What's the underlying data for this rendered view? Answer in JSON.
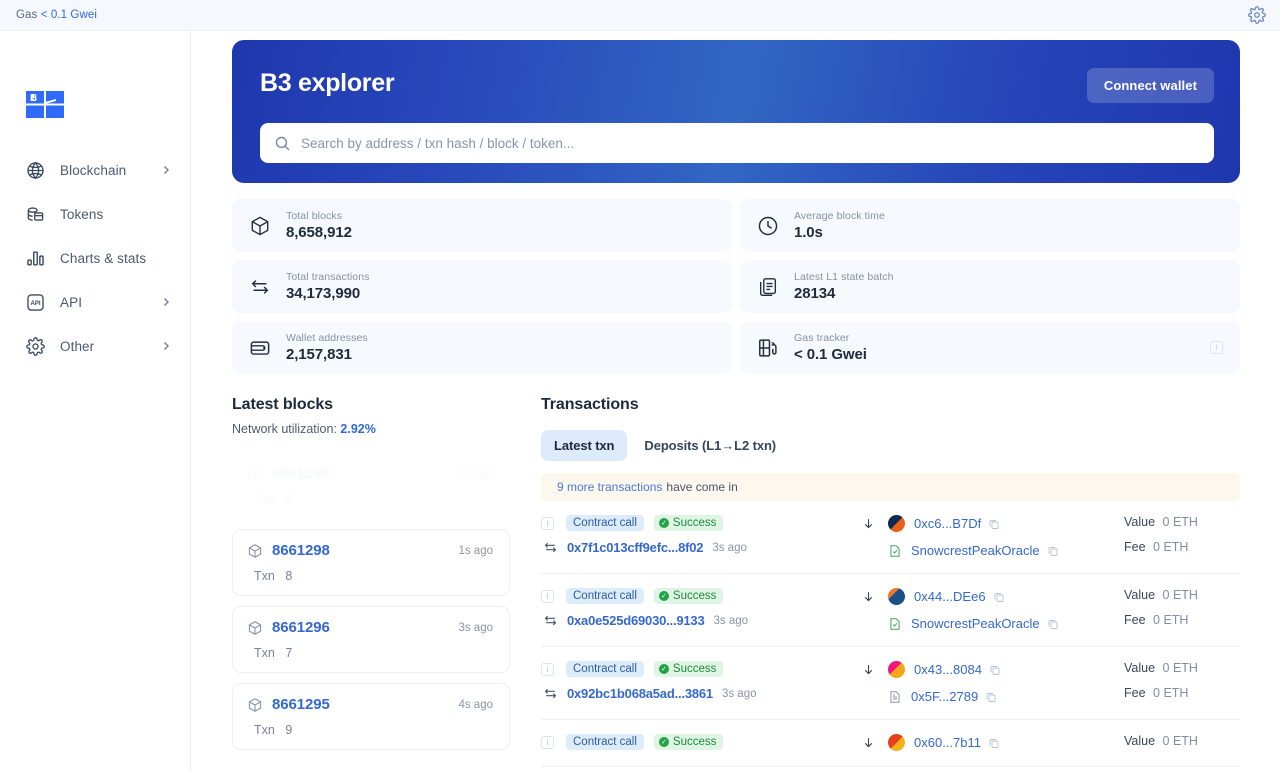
{
  "topbar": {
    "gas_prefix": "Gas",
    "gas_value": "< 0.1 Gwei",
    "gear_icon": "gear-icon"
  },
  "sidebar": {
    "logo_text": "B3",
    "items": [
      {
        "label": "Blockchain",
        "icon": "globe-icon",
        "has_chevron": true
      },
      {
        "label": "Tokens",
        "icon": "coins-icon",
        "has_chevron": false
      },
      {
        "label": "Charts & stats",
        "icon": "bars-icon",
        "has_chevron": false
      },
      {
        "label": "API",
        "icon": "api-icon",
        "has_chevron": true
      },
      {
        "label": "Other",
        "icon": "gear-icon",
        "has_chevron": true
      }
    ]
  },
  "hero": {
    "title": "B3 explorer",
    "connect_label": "Connect wallet",
    "search_placeholder": "Search by address / txn hash / block / token...",
    "search_value": "",
    "search_icon": "search-icon",
    "gradient_from": "#1f37ae",
    "gradient_mid": "#3266c4"
  },
  "stats": {
    "left": [
      {
        "label": "Total blocks",
        "value": "8,658,912",
        "icon": "cube-icon"
      },
      {
        "label": "Total transactions",
        "value": "34,173,990",
        "icon": "swap-icon"
      },
      {
        "label": "Wallet addresses",
        "value": "2,157,831",
        "icon": "wallet-icon"
      }
    ],
    "right": [
      {
        "label": "Average block time",
        "value": "1.0s",
        "icon": "clock-icon",
        "info": false
      },
      {
        "label": "Latest L1 state batch",
        "value": "28134",
        "icon": "docs-icon",
        "info": false
      },
      {
        "label": "Gas tracker",
        "value": "< 0.1 Gwei",
        "icon": "gaspump-icon",
        "info": true
      }
    ]
  },
  "blocks": {
    "title": "Latest blocks",
    "netutil_label": "Network utilization:",
    "netutil_value": "2.92%",
    "txn_label": "Txn",
    "items": [
      {
        "number": "8661299",
        "age": "1s ago",
        "txn": "6",
        "ghost": true
      },
      {
        "number": "8661298",
        "age": "1s ago",
        "txn": "8",
        "ghost": false
      },
      {
        "number": "8661296",
        "age": "3s ago",
        "txn": "7",
        "ghost": false
      },
      {
        "number": "8661295",
        "age": "4s ago",
        "txn": "9",
        "ghost": false
      }
    ]
  },
  "transactions": {
    "title": "Transactions",
    "tabs": [
      {
        "label": "Latest txn",
        "active": true
      },
      {
        "label": "Deposits (L1→L2 txn)",
        "active": false
      }
    ],
    "notice_count": "9 more transactions",
    "notice_rest": "have come in",
    "value_label": "Value",
    "fee_label": "Fee",
    "rows": [
      {
        "type": "Contract call",
        "status": "Success",
        "hash": "0x7f1c013cff9efc...8f02",
        "age": "3s ago",
        "from": "0xc6...B7Df",
        "to": "SnowcrestPeakOracle",
        "avatar_a": "#0d2b4e",
        "avatar_b": "#e8601c",
        "to_icon": "verified-contract-icon",
        "value": "0 ETH",
        "fee": "0 ETH"
      },
      {
        "type": "Contract call",
        "status": "Success",
        "hash": "0xa0e525d69030...9133",
        "age": "3s ago",
        "from": "0x44...DEe6",
        "to": "SnowcrestPeakOracle",
        "avatar_a": "#1b4f8a",
        "avatar_b": "#ef7622",
        "to_icon": "verified-contract-icon",
        "value": "0 ETH",
        "fee": "0 ETH"
      },
      {
        "type": "Contract call",
        "status": "Success",
        "hash": "0x92bc1b068a5ad...3861",
        "age": "3s ago",
        "from": "0x43...8084",
        "to": "0x5F...2789",
        "avatar_a": "#f0187f",
        "avatar_b": "#f3a718",
        "to_icon": "contract-icon",
        "value": "0 ETH",
        "fee": "0 ETH"
      },
      {
        "type": "Contract call",
        "status": "Success",
        "hash": "",
        "age": "",
        "from": "0x60...7b11",
        "to": "",
        "avatar_a": "#e8401c",
        "avatar_b": "#f3b218",
        "to_icon": "contract-icon",
        "value": "0 ETH",
        "fee": ""
      }
    ]
  }
}
